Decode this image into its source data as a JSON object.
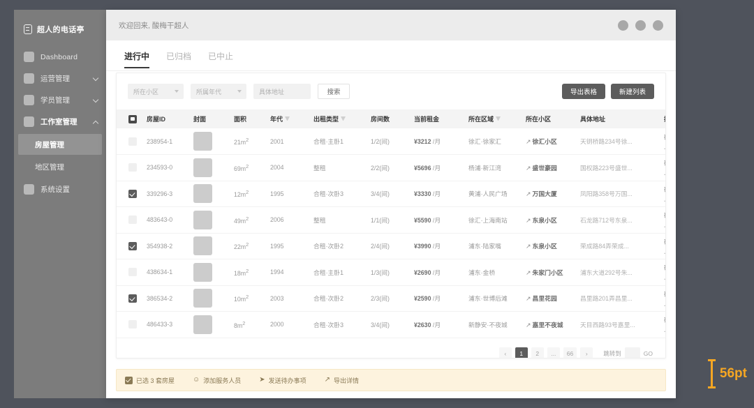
{
  "sidebar": {
    "brand": "超人的电话亭",
    "items": [
      {
        "label": "Dashboard",
        "type": "plain",
        "english": true
      },
      {
        "label": "运营管理",
        "type": "expandable",
        "expanded": false
      },
      {
        "label": "学员管理",
        "type": "expandable",
        "expanded": false
      },
      {
        "label": "工作室管理",
        "type": "expandable",
        "expanded": true
      }
    ],
    "subitems": [
      {
        "label": "房屋管理",
        "selected": true
      },
      {
        "label": "地区管理",
        "selected": false
      }
    ],
    "last_item": {
      "label": "系统设置",
      "type": "plain"
    }
  },
  "topbar": {
    "welcome": "欢迎回来, 酸梅干超人"
  },
  "tabs": [
    {
      "label": "进行中",
      "active": true
    },
    {
      "label": "已归档",
      "active": false
    },
    {
      "label": "已中止",
      "active": false
    }
  ],
  "filters": {
    "community_placeholder": "所在小区",
    "decade_placeholder": "所属年代",
    "address_placeholder": "具体地址",
    "search_label": "搜索",
    "export_label": "导出表格",
    "new_list_label": "新建列表"
  },
  "table": {
    "columns": [
      {
        "label": "",
        "key": "check"
      },
      {
        "label": "房屋ID",
        "key": "id"
      },
      {
        "label": "封面",
        "key": "cover"
      },
      {
        "label": "面积",
        "key": "area"
      },
      {
        "label": "年代",
        "key": "year",
        "filter": true
      },
      {
        "label": "出租类型",
        "key": "type",
        "filter": true
      },
      {
        "label": "房间数",
        "key": "rooms"
      },
      {
        "label": "当前租金",
        "key": "rent"
      },
      {
        "label": "所在区域",
        "key": "region",
        "filter": true
      },
      {
        "label": "所在小区",
        "key": "community"
      },
      {
        "label": "具体地址",
        "key": "address"
      },
      {
        "label": "操作",
        "key": "ops"
      }
    ],
    "op_labels": [
      "确认详情",
      "上线房屋"
    ],
    "rows": [
      {
        "checked": false,
        "id": "238954-1",
        "area": "21m",
        "year": "2001",
        "type": "合租·主卧1",
        "rooms": "1/2(间)",
        "rent": "¥3212",
        "rent_unit": "/月",
        "region": "徐汇·徐家汇",
        "community": "徐汇小区",
        "address": "天钥桥路234号徐..."
      },
      {
        "checked": false,
        "id": "234593-0",
        "area": "69m",
        "year": "2004",
        "type": "整租",
        "rooms": "2/2(间)",
        "rent": "¥5696",
        "rent_unit": "/月",
        "region": "杨浦·新江湾",
        "community": "盛世豪园",
        "address": "国权路223号盛世..."
      },
      {
        "checked": true,
        "id": "339296-3",
        "area": "12m",
        "year": "1995",
        "type": "合租·次卧3",
        "rooms": "3/4(间)",
        "rent": "¥3330",
        "rent_unit": "/月",
        "region": "黄浦·人民广场",
        "community": "万国大厦",
        "address": "凤阳路358号万国..."
      },
      {
        "checked": false,
        "id": "483643-0",
        "area": "49m",
        "year": "2006",
        "type": "整租",
        "rooms": "1/1(间)",
        "rent": "¥5590",
        "rent_unit": "/月",
        "region": "徐汇·上海南站",
        "community": "东泉小区",
        "address": "石龙路712号东泉..."
      },
      {
        "checked": true,
        "id": "354938-2",
        "area": "22m",
        "year": "1995",
        "type": "合租·次卧2",
        "rooms": "2/4(间)",
        "rent": "¥3990",
        "rent_unit": "/月",
        "region": "浦东·陆家嘴",
        "community": "东泉小区",
        "address": "荣成路84弄荣成..."
      },
      {
        "checked": false,
        "id": "438634-1",
        "area": "18m",
        "year": "1994",
        "type": "合租·主卧1",
        "rooms": "1/3(间)",
        "rent": "¥2690",
        "rent_unit": "/月",
        "region": "浦东·金桥",
        "community": "朱家门小区",
        "address": "浦东大道292号朱..."
      },
      {
        "checked": true,
        "id": "386534-2",
        "area": "10m",
        "year": "2003",
        "type": "合租·次卧2",
        "rooms": "2/3(间)",
        "rent": "¥2590",
        "rent_unit": "/月",
        "region": "浦东·世博后滩",
        "community": "昌里花园",
        "address": "昌里路201弄昌里..."
      },
      {
        "checked": false,
        "id": "486433-3",
        "area": "8m",
        "year": "2000",
        "type": "合租·次卧3",
        "rooms": "3/4(间)",
        "rent": "¥2630",
        "rent_unit": "/月",
        "region": "新静安·不夜城",
        "community": "嘉里不夜城",
        "address": "天目西路93号嘉里..."
      }
    ]
  },
  "pagination": {
    "prev": "‹",
    "pages": [
      "1",
      "2",
      "...",
      "66"
    ],
    "next": "›",
    "active_page": "1",
    "jump_label": "跳转到",
    "go_label": "GO"
  },
  "action_bar": {
    "selection_label": "已选 3 套房屋",
    "actions": [
      {
        "label": "添加服务人员",
        "icon": "add-person-icon"
      },
      {
        "label": "发送待办事项",
        "icon": "send-icon"
      },
      {
        "label": "导出详情",
        "icon": "export-icon"
      }
    ]
  },
  "annotation": {
    "label": "56pt",
    "color": "#f5a623"
  }
}
